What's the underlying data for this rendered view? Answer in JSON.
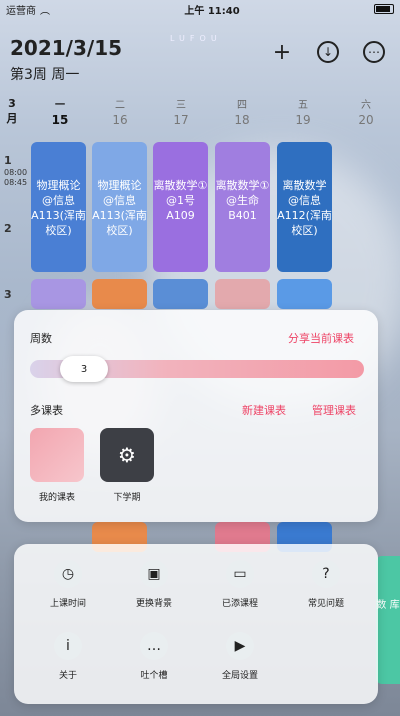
{
  "status_bar": {
    "carrier": "运营商",
    "time": "上午 11:40"
  },
  "header": {
    "date": "2021/3/15",
    "week_label": "第3周",
    "weekday": "周一",
    "watermark": "LUFOU"
  },
  "days": {
    "month": "3月",
    "columns": [
      {
        "weekday": "一",
        "date": "15"
      },
      {
        "weekday": "二",
        "date": "16"
      },
      {
        "weekday": "三",
        "date": "17"
      },
      {
        "weekday": "四",
        "date": "18"
      },
      {
        "weekday": "五",
        "date": "19"
      },
      {
        "weekday": "六",
        "date": "20"
      }
    ]
  },
  "periods": [
    {
      "n": "1",
      "start": "08:00",
      "end": "08:45"
    },
    {
      "n": "2",
      "start": "",
      "end": ""
    },
    {
      "n": "3",
      "start": "",
      "end": ""
    }
  ],
  "courses": [
    {
      "text": "物理概论 @信息 A113(浑南校区)",
      "color": "#4a7fd4"
    },
    {
      "text": "物理概论 @信息 A113(浑南校区)",
      "color": "#7fa8e6"
    },
    {
      "text": "离散数学① @1号 A109",
      "color": "#9a6fe0"
    },
    {
      "text": "离散数学① @生命 B401",
      "color": "#a07ee0"
    },
    {
      "text": "离散数学 @信息 A112(浑南校区)",
      "color": "#2f6fc0"
    }
  ],
  "sheet": {
    "weeks_label": "周数",
    "share_link": "分享当前课表",
    "week_value": "3",
    "multi_label": "多课表",
    "new_link": "新建课表",
    "manage_link": "管理课表",
    "tables": [
      {
        "label": "我的课表"
      },
      {
        "label": "下学期"
      }
    ]
  },
  "grid": [
    {
      "label": "上课时间",
      "icon": "clock-icon"
    },
    {
      "label": "更换背景",
      "icon": "image-icon"
    },
    {
      "label": "已添课程",
      "icon": "archive-icon"
    },
    {
      "label": "常见问题",
      "icon": "question-icon"
    },
    {
      "label": "关于",
      "icon": "info-icon"
    },
    {
      "label": "吐个槽",
      "icon": "chat-icon"
    },
    {
      "label": "全局设置",
      "icon": "play-icon"
    }
  ],
  "side_tab": {
    "text": "数 库"
  }
}
